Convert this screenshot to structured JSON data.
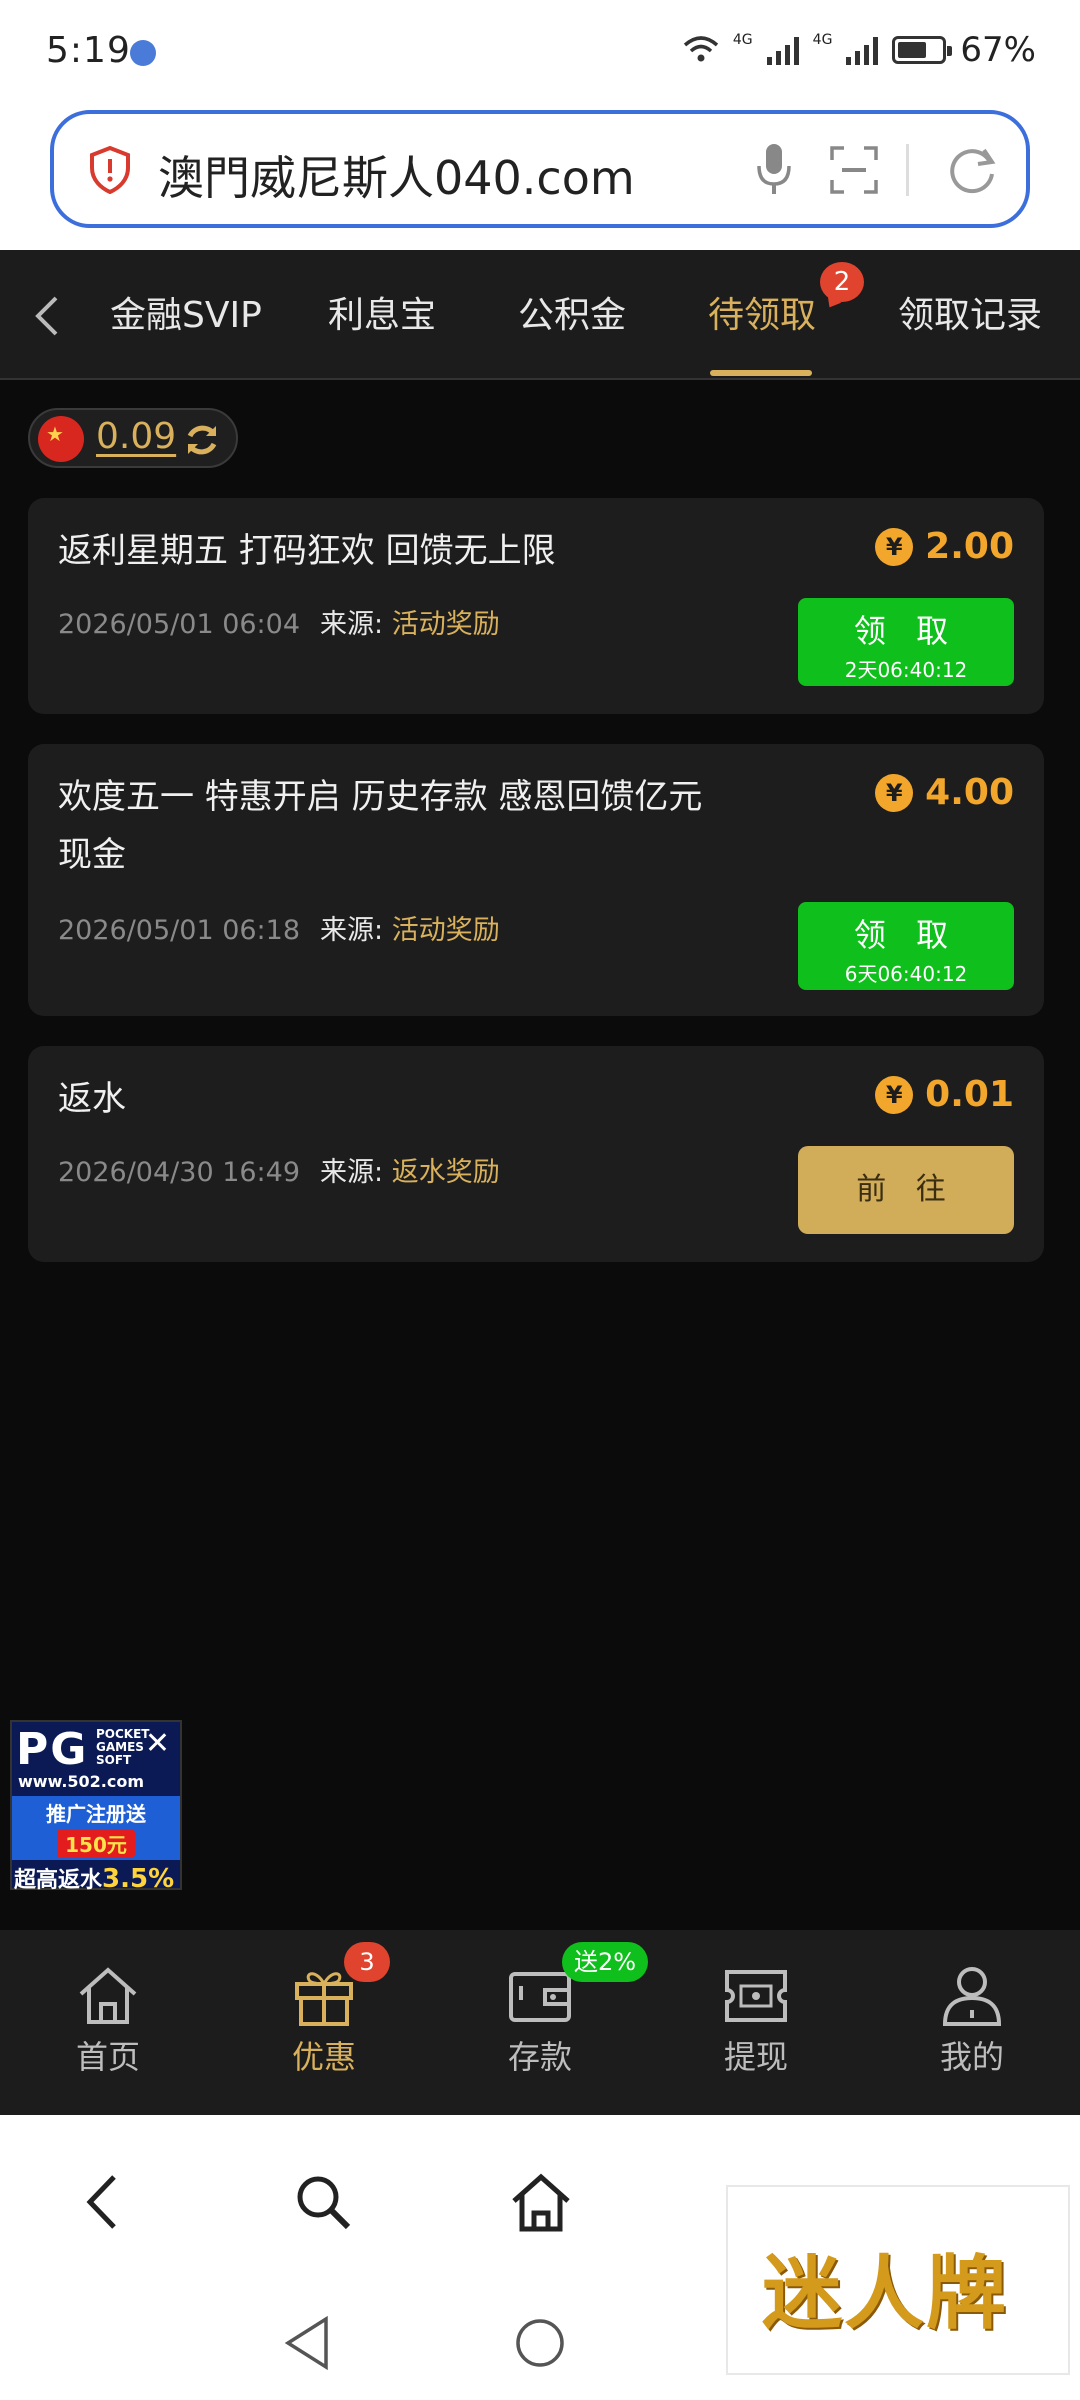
{
  "status_bar": {
    "time": "5:19",
    "battery": "67%",
    "net1": "4G",
    "net2": "4G"
  },
  "browser": {
    "url": "澳門威尼斯人040.com"
  },
  "tabs": [
    {
      "label": "金融SVIP"
    },
    {
      "label": "利息宝"
    },
    {
      "label": "公积金"
    },
    {
      "label": "待领取",
      "active": true,
      "badge": "2"
    },
    {
      "label": "领取记录"
    }
  ],
  "balance": {
    "value": "0.09"
  },
  "rewards": [
    {
      "title": "返利星期五 打码狂欢 回馈无上限",
      "amount": "2.00",
      "date": "2026/05/01 06:04",
      "source_label": "来源:",
      "source": "活动奖励",
      "button": "领 取",
      "countdown": "2天06:40:12"
    },
    {
      "title": "欢度五一 特惠开启 历史存款 感恩回馈亿元现金",
      "amount": "4.00",
      "date": "2026/05/01 06:18",
      "source_label": "来源:",
      "source": "活动奖励",
      "button": "领 取",
      "countdown": "6天06:40:12"
    },
    {
      "title": "返水",
      "amount": "0.01",
      "date": "2026/04/30 16:49",
      "source_label": "来源:",
      "source": "返水奖励",
      "button": "前 往"
    }
  ],
  "promo": {
    "brand": "PG",
    "brand_sub": "POCKET GAMES SOFT",
    "site": "www.502.com",
    "line1": "推广注册送",
    "amount": "150元",
    "line2": "超高返水",
    "rate": "3.5%"
  },
  "bottom_nav": [
    {
      "label": "首页",
      "icon": "home-icon"
    },
    {
      "label": "优惠",
      "icon": "gift-icon",
      "badge": "3",
      "active": true
    },
    {
      "label": "存款",
      "icon": "wallet-icon",
      "badge": "送2%"
    },
    {
      "label": "提现",
      "icon": "withdraw-icon"
    },
    {
      "label": "我的",
      "icon": "user-icon"
    }
  ],
  "watermark": "迷人牌",
  "colors": {
    "accent": "#d9b15c",
    "claim_green": "#0fbf1b",
    "coin": "#f2a62b",
    "badge_red": "#e0442e"
  }
}
